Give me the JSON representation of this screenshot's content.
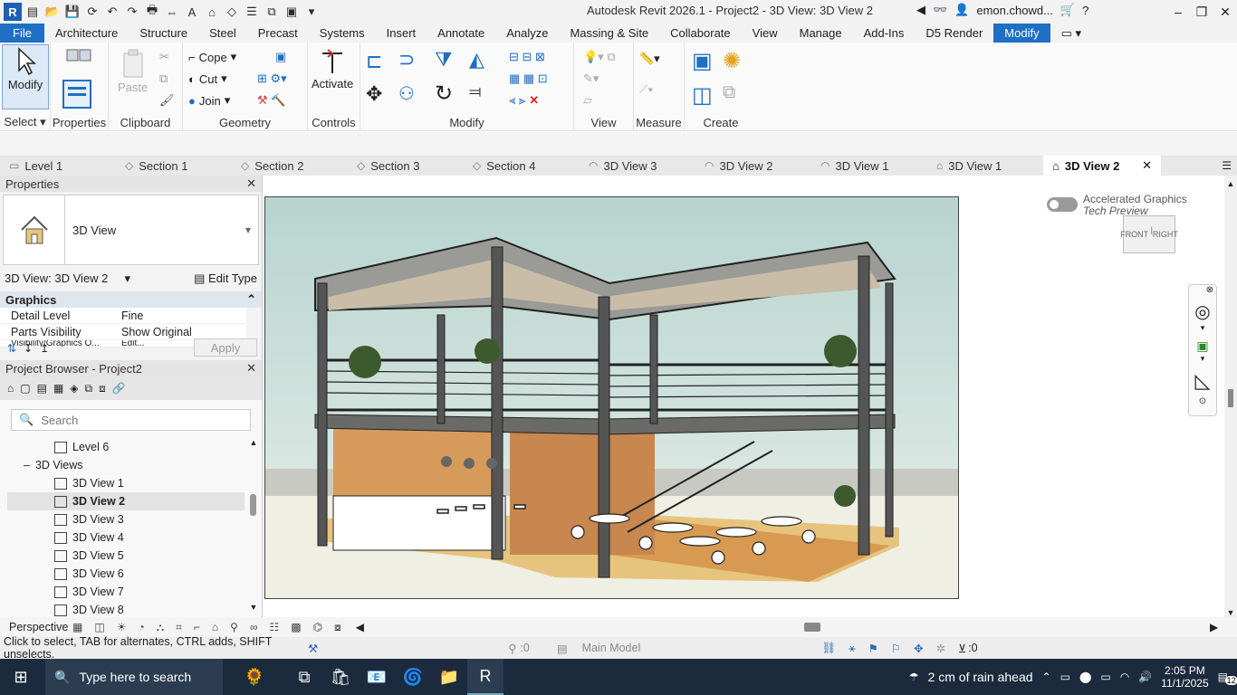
{
  "window": {
    "title": "Autodesk Revit 2026.1 - Project2 - 3D View: 3D View 2",
    "user": "emon.chowd..."
  },
  "menu": [
    "File",
    "Architecture",
    "Structure",
    "Steel",
    "Precast",
    "Systems",
    "Insert",
    "Annotate",
    "Analyze",
    "Massing & Site",
    "Collaborate",
    "View",
    "Manage",
    "Add-Ins",
    "D5 Render",
    "Modify"
  ],
  "ribbon": {
    "select_label": "Select",
    "modify_label": "Modify",
    "properties_label": "Properties",
    "paste_label": "Paste",
    "clipboard_label": "Clipboard",
    "cope_label": "Cope",
    "cut_label": "Cut",
    "join_label": "Join",
    "geometry_label": "Geometry",
    "activate_label": "Activate",
    "controls_label": "Controls",
    "modify_group_label": "Modify",
    "view_label": "View",
    "measure_label": "Measure",
    "create_label": "Create"
  },
  "tabs": [
    "Level 1",
    "Section 1",
    "Section 2",
    "Section 3",
    "Section 4",
    "3D View 3",
    "3D View 2",
    "3D View 1",
    "3D View 1",
    "3D View 2"
  ],
  "properties": {
    "title": "Properties",
    "type_name": "3D View",
    "instance": "3D View: 3D View 2",
    "edit_type": "Edit Type",
    "section": "Graphics",
    "rows": [
      {
        "k": "Detail Level",
        "v": "Fine"
      },
      {
        "k": "Parts Visibility",
        "v": "Show Original"
      },
      {
        "k": "Visibility/Graphics O...",
        "v": "Edit..."
      }
    ],
    "apply": "Apply"
  },
  "browser": {
    "title": "Project Browser - Project2",
    "search_placeholder": "Search",
    "items": [
      {
        "label": "Level 6",
        "kind": "view"
      },
      {
        "label": "3D Views",
        "kind": "group"
      },
      {
        "label": "3D View 1",
        "kind": "view"
      },
      {
        "label": "3D View 2",
        "kind": "view",
        "selected": true
      },
      {
        "label": "3D View 3",
        "kind": "view"
      },
      {
        "label": "3D View 4",
        "kind": "view"
      },
      {
        "label": "3D View 5",
        "kind": "view"
      },
      {
        "label": "3D View 6",
        "kind": "view"
      },
      {
        "label": "3D View 7",
        "kind": "view"
      },
      {
        "label": "3D View 8",
        "kind": "view"
      }
    ]
  },
  "canvas": {
    "accelerated_title": "Accelerated Graphics",
    "accelerated_sub": "Tech Preview",
    "viewcube_front": "FRONT",
    "viewcube_right": "RIGHT"
  },
  "viewcontrol": {
    "mode": "Perspective"
  },
  "status": {
    "hint": "Click to select, TAB for alternates, CTRL adds, SHIFT unselects.",
    "count1": ":0",
    "model": "Main Model",
    "filter_count": ":0"
  },
  "taskbar": {
    "search_placeholder": "Type here to search",
    "weather": "2 cm of rain ahead",
    "time": "2:05 PM",
    "date": "11/1/2025",
    "notif": "12"
  }
}
